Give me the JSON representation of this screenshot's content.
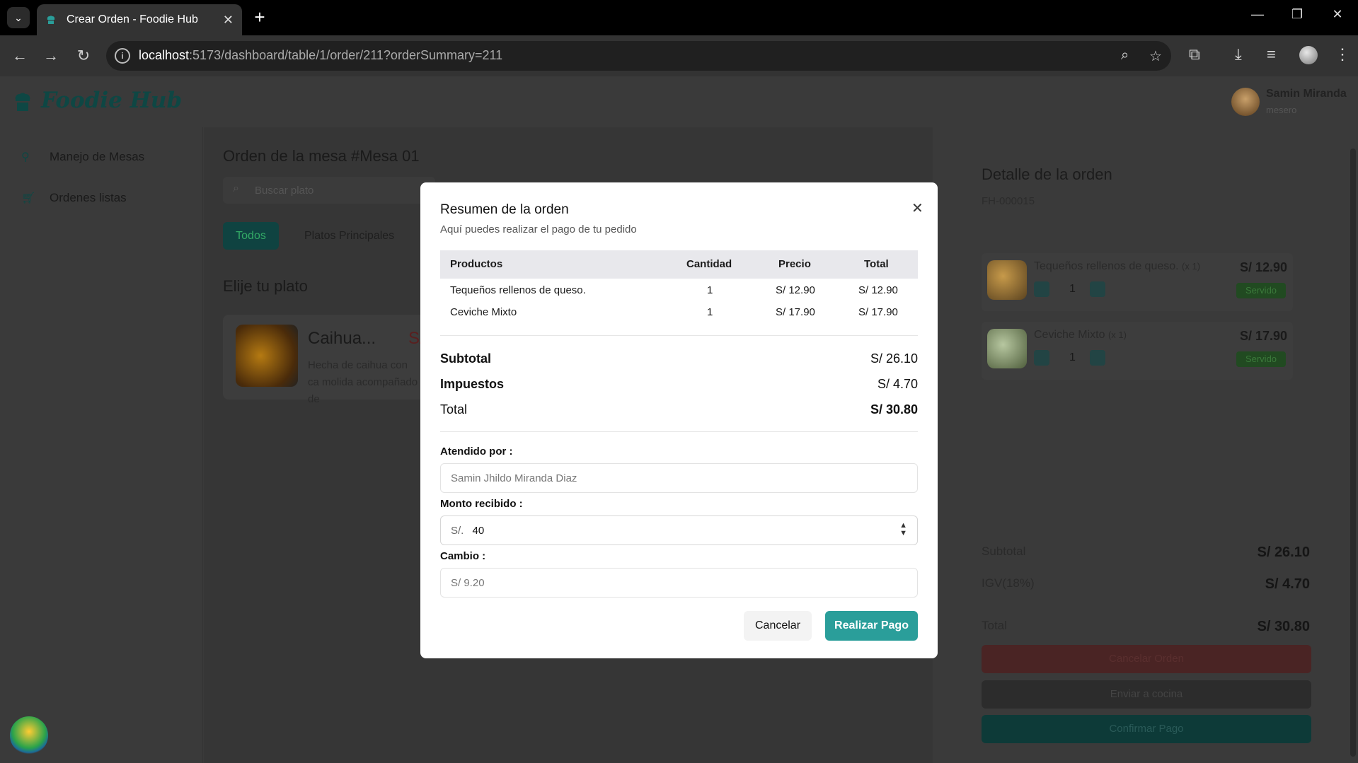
{
  "browser": {
    "tab_title": "Crear Orden - Foodie Hub",
    "tab_close": "✕",
    "new_tab": "+",
    "url_host": "localhost",
    "url_rest": ":5173/dashboard/table/1/order/211?orderSummary=211"
  },
  "app": {
    "logo": "Foodie Hub",
    "user": {
      "name": "Samin Miranda",
      "role": "mesero"
    }
  },
  "sidebar": {
    "items": [
      {
        "label": "Manejo de Mesas",
        "icon": "tables-icon"
      },
      {
        "label": "Ordenes listas",
        "icon": "cart-icon"
      }
    ]
  },
  "main": {
    "title": "Orden de la mesa #Mesa 01",
    "search_placeholder": "Buscar plato",
    "filters": [
      "Todos",
      "Platos Principales"
    ],
    "choose_title": "Elije tu plato",
    "dish": {
      "name": "Caihua...",
      "price": "S/ 29",
      "desc": "Hecha de caihua con ca molida acompañado de"
    }
  },
  "detail": {
    "title": "Detalle de la orden",
    "code": "FH-000015",
    "items": [
      {
        "name": "Tequeños rellenos de queso.",
        "qty_label": "(x 1)",
        "price": "S/ 12.90",
        "qty": "1",
        "status": "Servido"
      },
      {
        "name": "Ceviche Mixto",
        "qty_label": "(x 1)",
        "price": "S/ 17.90",
        "qty": "1",
        "status": "Servido"
      }
    ],
    "subtotal_label": "Subtotal",
    "subtotal": "S/ 26.10",
    "igv_label": "IGV(18%)",
    "igv": "S/ 4.70",
    "total_label": "Total",
    "total": "S/ 30.80",
    "buttons": {
      "cancel": "Cancelar Orden",
      "kitchen": "Enviar a cocina",
      "confirm": "Confirmar Pago"
    }
  },
  "modal": {
    "title": "Resumen de la orden",
    "subtitle": "Aquí puedes realizar el pago de tu pedido",
    "columns": [
      "Productos",
      "Cantidad",
      "Precio",
      "Total"
    ],
    "rows": [
      [
        "Tequeños rellenos de queso.",
        "1",
        "S/ 12.90",
        "S/ 12.90"
      ],
      [
        "Ceviche Mixto",
        "1",
        "S/ 17.90",
        "S/ 17.90"
      ]
    ],
    "subtotal_label": "Subtotal",
    "subtotal": "S/ 26.10",
    "tax_label": "Impuestos",
    "tax": "S/ 4.70",
    "total_label": "Total",
    "total": "S/ 30.80",
    "attended_label": "Atendido por :",
    "attended_value": "Samin Jhildo Miranda Diaz",
    "amount_label": "Monto recibido :",
    "amount_prefix": "S/.",
    "amount_value": "40",
    "change_label": "Cambio :",
    "change_value": "S/ 9.20",
    "cancel_btn": "Cancelar",
    "pay_btn": "Realizar Pago"
  },
  "colors": {
    "accent": "#2a9e9a",
    "brand": "#0e4744",
    "overlay": "#3a3a3a"
  }
}
